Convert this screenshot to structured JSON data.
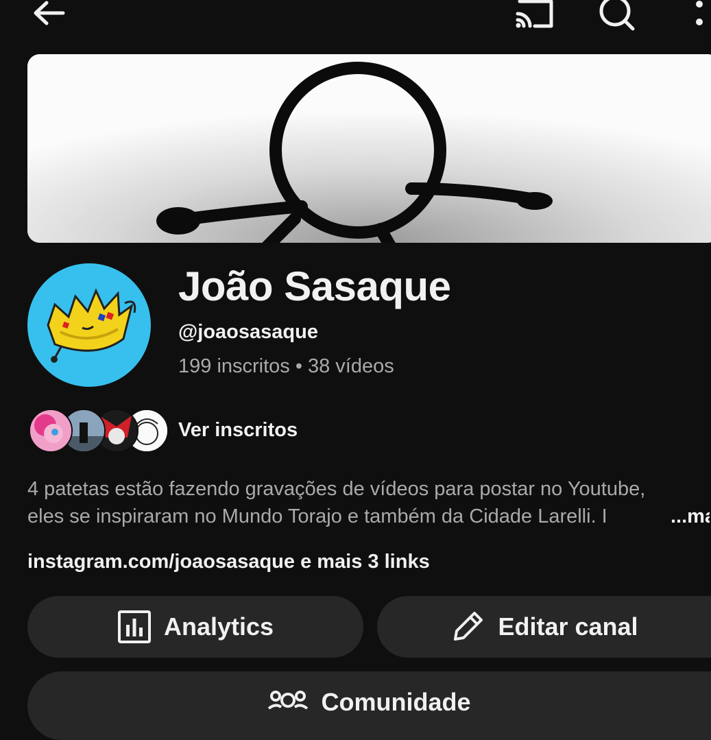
{
  "topbar": {
    "back_icon": "arrow-left-icon",
    "cast_icon": "cast-icon",
    "search_icon": "search-icon",
    "more_icon": "more-vertical-icon"
  },
  "channel": {
    "name": "João Sasaque",
    "handle": "@joaosasaque",
    "subscribers": "199 inscritos",
    "separator": "•",
    "videos": "38 vídeos"
  },
  "subscribers_preview": {
    "label": "Ver inscritos"
  },
  "description": {
    "line1": "4 patetas estão fazendo gravações de vídeos para postar no Youtube,",
    "line2": "eles se inspiraram no Mundo Torajo e também da Cidade Larelli. I",
    "more": "...mais"
  },
  "links": {
    "text": "instagram.com/joaosasaque e mais 3 links"
  },
  "buttons": {
    "analytics": "Analytics",
    "edit_channel": "Editar canal",
    "community": "Comunidade"
  },
  "colors": {
    "background": "#0f0f0f",
    "button_bg": "#272727",
    "avatar_bg": "#37c0ee",
    "secondary_text": "#aaaaaa"
  }
}
